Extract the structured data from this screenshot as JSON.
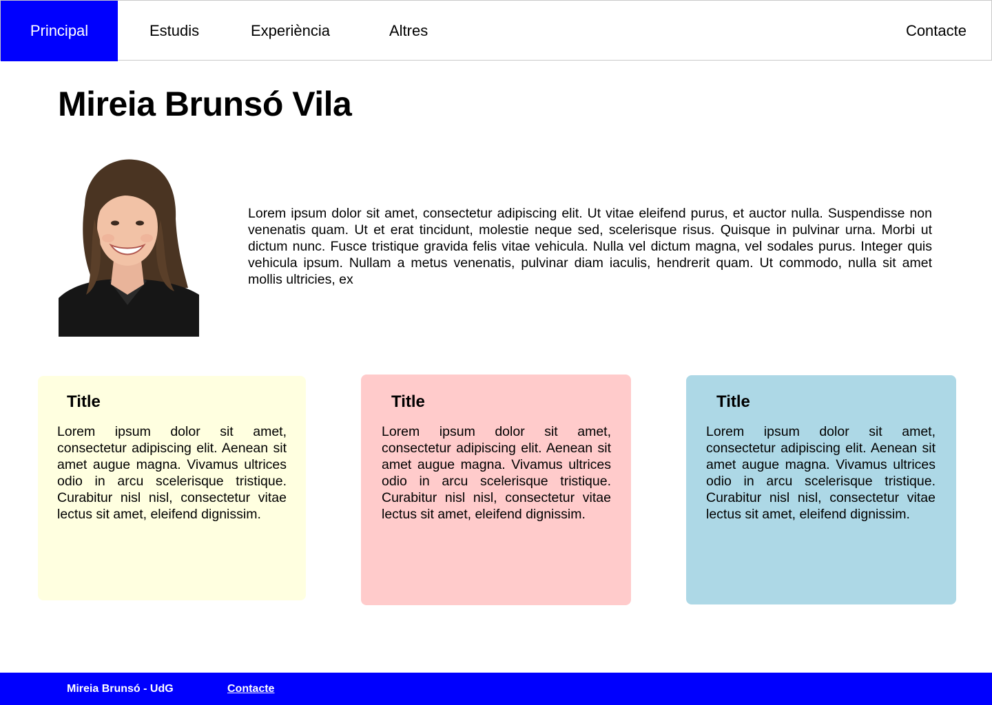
{
  "nav": {
    "items": [
      {
        "label": "Principal",
        "active": true
      },
      {
        "label": "Estudis"
      },
      {
        "label": "Experiència"
      },
      {
        "label": "Altres"
      }
    ],
    "contact_label": "Contacte",
    "accent_color": "#0000fe"
  },
  "page": {
    "title": "Mireia Brunsó Vila",
    "bio": "Lorem ipsum dolor sit amet, consectetur adipiscing elit. Ut vitae eleifend purus, et auctor nulla. Suspendisse non venenatis quam. Ut et erat tincidunt, molestie neque sed, scelerisque risus. Quisque in pulvinar urna. Morbi ut dictum nunc. Fusce tristique gravida felis vitae vehicula. Nulla vel dictum magna, vel sodales purus. Integer quis vehicula ipsum. Nullam a metus venenatis, pulvinar diam iaculis, hendrerit quam. Ut commodo, nulla sit amet mollis ultricies, ex"
  },
  "cards": [
    {
      "title": "Title",
      "text": "Lorem ipsum dolor sit amet, consectetur adipiscing elit. Aenean sit amet augue magna. Vivamus ultrices odio in arcu scelerisque tristique. Curabitur nisl nisl, consectetur vitae lectus sit amet, eleifend dignissim.",
      "color": "#ffffe0"
    },
    {
      "title": "Title",
      "text": "Lorem ipsum dolor sit amet, consectetur adipiscing elit. Aenean sit amet augue magna. Vivamus ultrices odio in arcu scelerisque tristique. Curabitur nisl nisl, consectetur vitae lectus sit amet, eleifend dignissim.",
      "color": "#ffcbcb"
    },
    {
      "title": "Title",
      "text": "Lorem ipsum dolor sit amet, consectetur adipiscing elit. Aenean sit amet augue magna. Vivamus ultrices odio in arcu scelerisque tristique. Curabitur nisl nisl, consectetur vitae lectus sit amet, eleifend dignissim.",
      "color": "#add8e6"
    }
  ],
  "footer": {
    "name": "Mireia Brunsó - UdG",
    "link_label": "Contacte"
  }
}
